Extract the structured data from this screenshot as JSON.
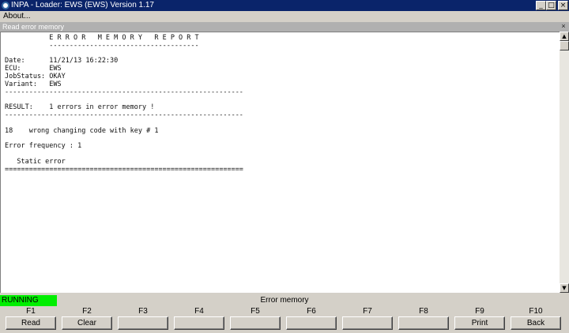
{
  "window": {
    "title": "INPA - Loader:  EWS (EWS) Version 1.17"
  },
  "menu": {
    "about": "About..."
  },
  "child_window": {
    "title": "Read error memory"
  },
  "report": {
    "lines": [
      "           E R R O R   M E M O R Y   R E P O R T",
      "           -------------------------------------",
      "",
      "Date:      11/21/13 16:22:30",
      "ECU:       EWS",
      "JobStatus: OKAY",
      "Variant:   EWS",
      "-----------------------------------------------------------",
      "",
      "RESULT:    1 errors in error memory !",
      "-----------------------------------------------------------",
      "",
      "18    wrong changing code with key # 1",
      "",
      "Error frequency : 1",
      "",
      "   Static error",
      "==========================================================="
    ]
  },
  "status": {
    "state": "RUNNING",
    "title": "Error memory"
  },
  "fkeys": [
    {
      "key": "F1",
      "label": "Read"
    },
    {
      "key": "F2",
      "label": "Clear"
    },
    {
      "key": "F3",
      "label": ""
    },
    {
      "key": "F4",
      "label": ""
    },
    {
      "key": "F5",
      "label": ""
    },
    {
      "key": "F6",
      "label": ""
    },
    {
      "key": "F7",
      "label": ""
    },
    {
      "key": "F8",
      "label": ""
    },
    {
      "key": "F9",
      "label": "Print"
    },
    {
      "key": "F10",
      "label": "Back"
    }
  ],
  "icons": {
    "app": "bmw-logo-icon",
    "minimize": "minimize-icon",
    "maximize": "maximize-icon",
    "close": "close-icon"
  },
  "colors": {
    "titlebar": "#0a246a",
    "running": "#00ee00",
    "face": "#d4d0c8"
  }
}
